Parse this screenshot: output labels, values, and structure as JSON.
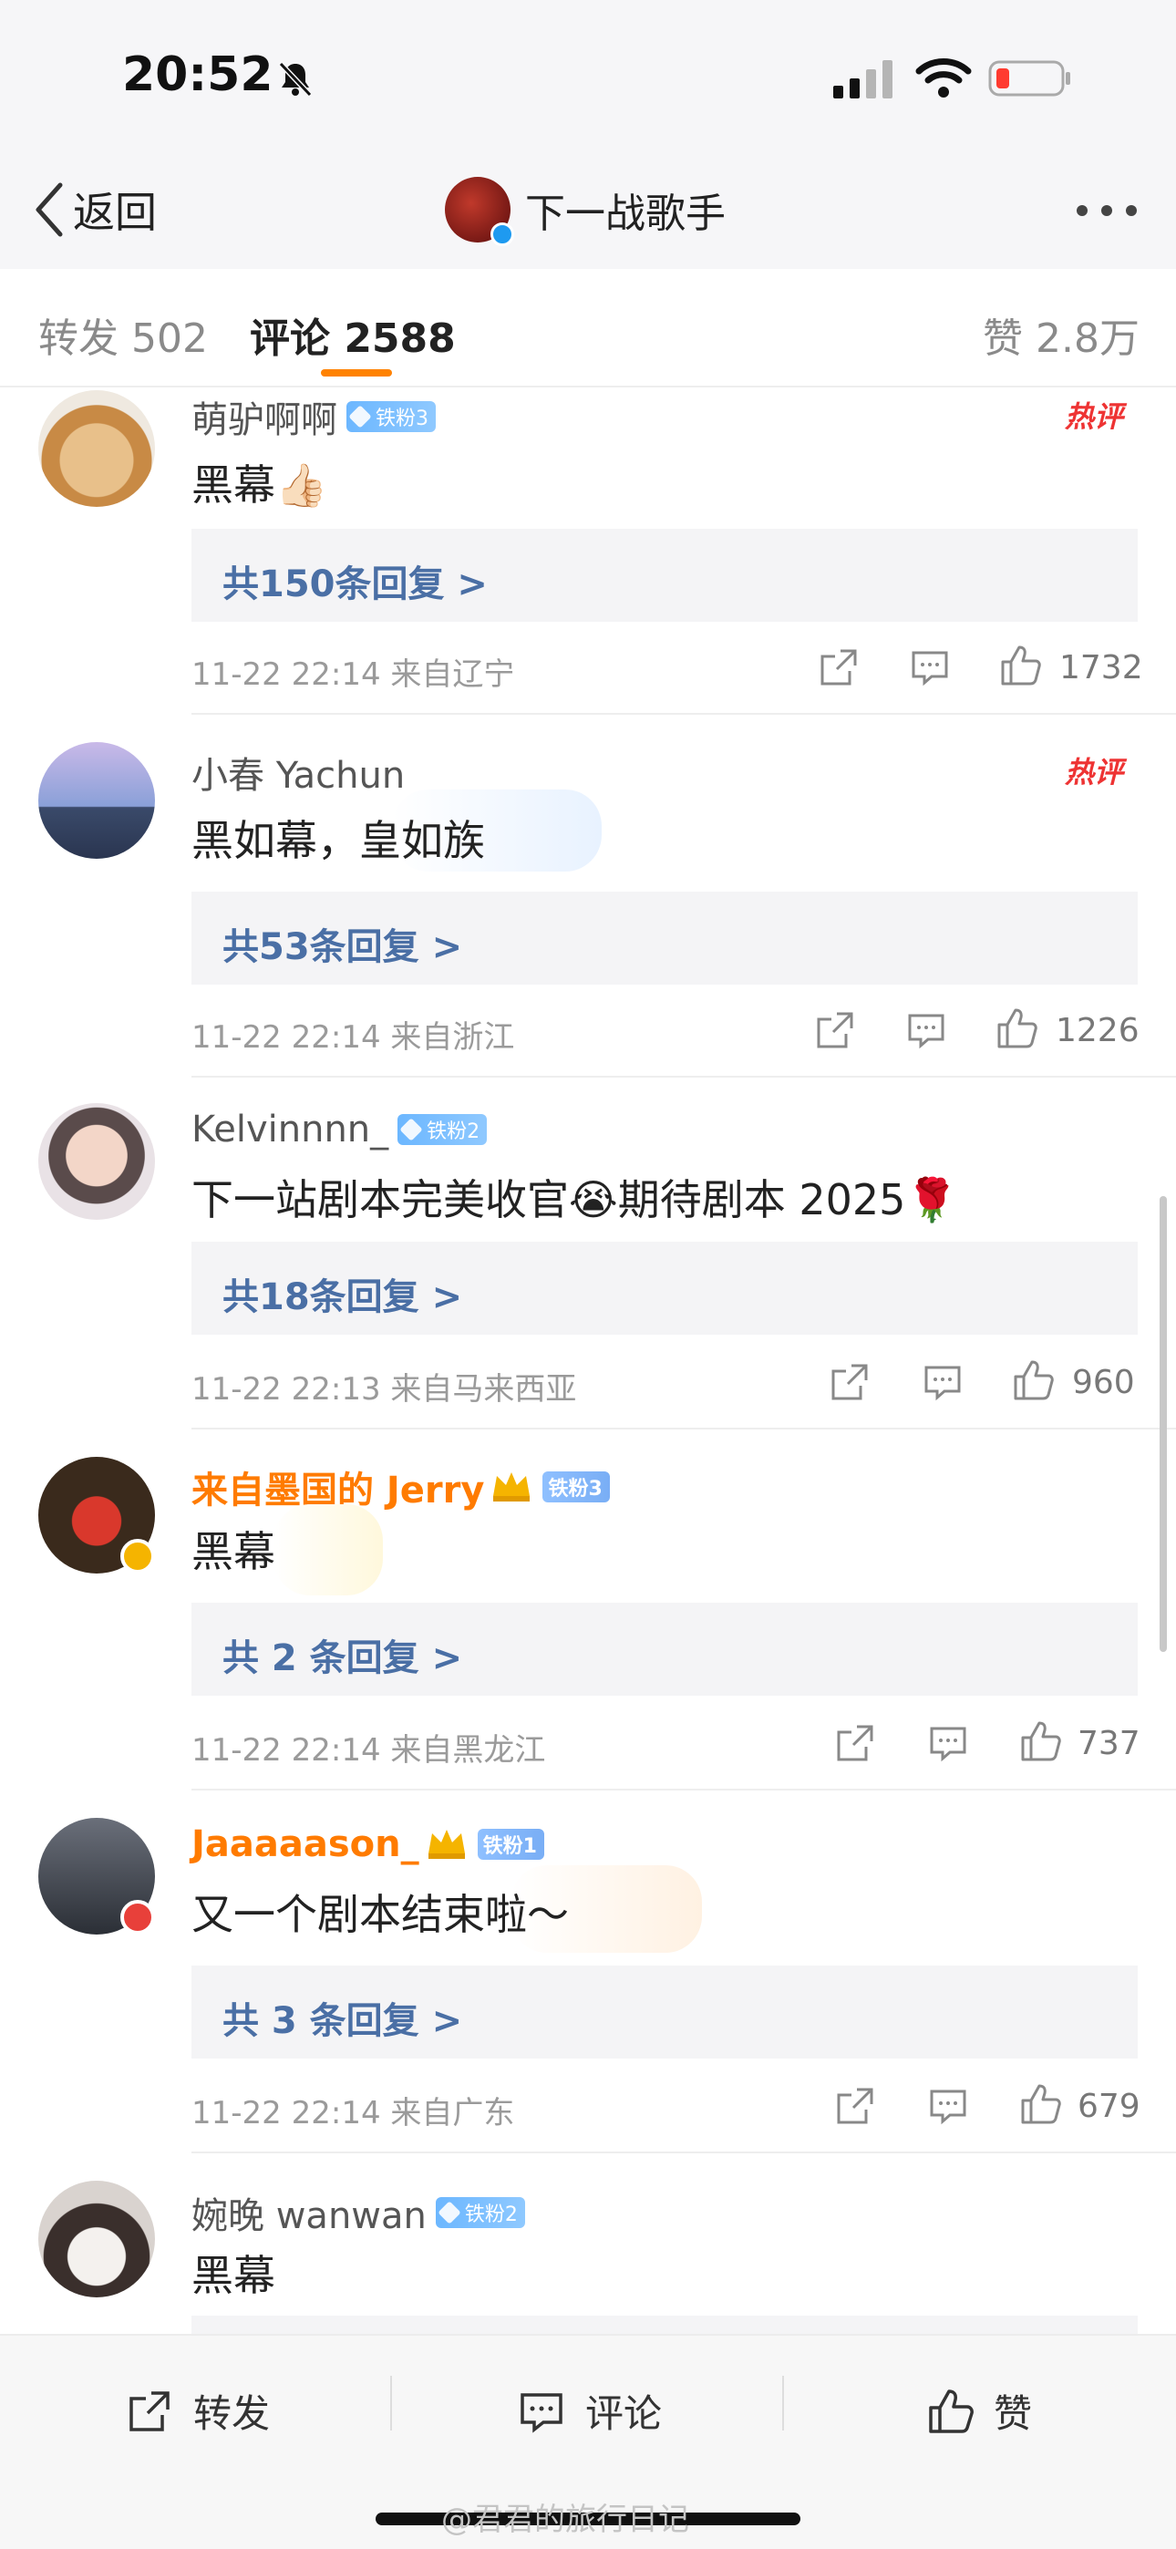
{
  "status_bar": {
    "time": "20:52"
  },
  "nav": {
    "back_label": "返回",
    "title": "下一战歌手"
  },
  "tabs": [
    {
      "label": "转发 502"
    },
    {
      "label": "评论 2588"
    },
    {
      "label": "赞 2.8万"
    }
  ],
  "comments": [
    {
      "name": "萌驴啊啊",
      "badge": "铁粉3",
      "hot": "热评",
      "text": "黑幕👍🏻",
      "replies": "共150条回复 >",
      "meta": "11-22 22:14  来自辽宁",
      "likes": "1732"
    },
    {
      "name": "小春 Yachun",
      "badge": "",
      "hot": "热评",
      "text": "黑如幕，皇如族",
      "replies": "共53条回复 >",
      "meta": "11-22 22:14  来自浙江",
      "likes": "1226"
    },
    {
      "name": "Kelvinnnn_",
      "badge": "铁粉2",
      "hot": "",
      "text": "下一站剧本完美收官😭期待剧本 2025🌹",
      "replies": "共18条回复 >",
      "meta": "11-22 22:13  来自马来西亚",
      "likes": "960"
    },
    {
      "name": "来自墨国的 Jerry",
      "badge": "铁粉3",
      "hot": "",
      "text": "黑幕",
      "replies": "共 2 条回复 >",
      "meta": "11-22 22:14  来自黑龙江",
      "likes": "737"
    },
    {
      "name": "Jaaaaason_",
      "badge": "铁粉1",
      "hot": "",
      "text": "又一个剧本结束啦～",
      "replies": "共 3 条回复 >",
      "meta": "11-22 22:14  来自广东",
      "likes": "679"
    },
    {
      "name": "婉晚 wanwan",
      "badge": "铁粉2",
      "hot": "",
      "text": "黑幕",
      "replies": "",
      "meta": "",
      "likes": ""
    }
  ],
  "bottom_bar": {
    "share": "转发",
    "comment": "评论",
    "like": "赞"
  },
  "watermark": "@君君的旅行日记",
  "colors": {
    "accent": "#ff8200",
    "link": "#4a6fa5",
    "vip_name": "#ff7b00",
    "hot": "#ee3333"
  }
}
